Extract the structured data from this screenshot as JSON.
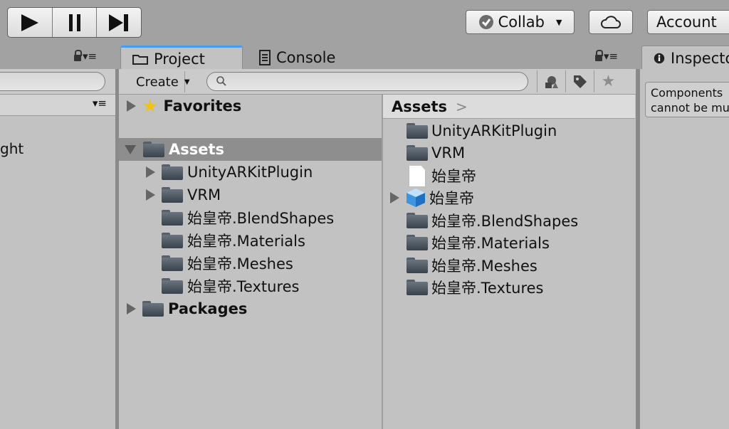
{
  "toolbar": {
    "collab_label": "Collab",
    "account_label": "Account"
  },
  "tabs": {
    "project": "Project",
    "console": "Console",
    "inspector": "Inspector"
  },
  "hierarchy": {
    "visible_item": "ght"
  },
  "project": {
    "create_label": "Create",
    "search_placeholder": "",
    "tree": {
      "favorites": "Favorites",
      "assets": "Assets",
      "asset_children": [
        "UnityARKitPlugin",
        "VRM",
        "始皇帝.BlendShapes",
        "始皇帝.Materials",
        "始皇帝.Meshes",
        "始皇帝.Textures"
      ],
      "packages": "Packages"
    },
    "content_header": "Assets",
    "content_items": [
      {
        "label": "UnityARKitPlugin",
        "icon": "folder-icon"
      },
      {
        "label": "VRM",
        "icon": "folder-icon"
      },
      {
        "label": "始皇帝",
        "icon": "file-icon"
      },
      {
        "label": "始皇帝",
        "icon": "cube-icon"
      },
      {
        "label": "始皇帝.BlendShapes",
        "icon": "folder-icon"
      },
      {
        "label": "始皇帝.Materials",
        "icon": "folder-icon"
      },
      {
        "label": "始皇帝.Meshes",
        "icon": "folder-icon"
      },
      {
        "label": "始皇帝.Textures",
        "icon": "folder-icon"
      }
    ]
  },
  "inspector": {
    "note_line1": "Components",
    "note_line2": "cannot be mu"
  },
  "colors": {
    "accent_tab": "#4a9cf0",
    "selected_row": "#8e8e8e",
    "panel": "#c2c2c2",
    "window_bg": "#a2a2a2"
  }
}
